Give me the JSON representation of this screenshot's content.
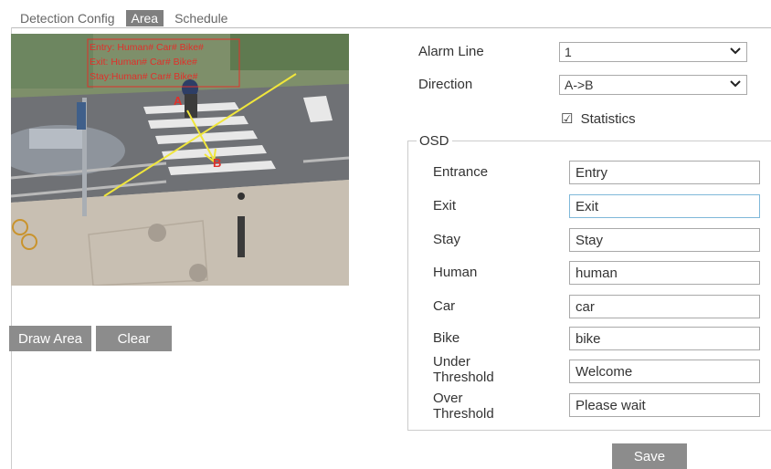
{
  "tabs": [
    {
      "label": "Detection Config",
      "active": false
    },
    {
      "label": "Area",
      "active": true
    },
    {
      "label": "Schedule",
      "active": false
    }
  ],
  "preview": {
    "overlay_lines": [
      "Entry:  Human# Car# Bike#",
      "Exit: Human# Car# Bike#",
      "Stay:Human# Car# Bike#"
    ],
    "point_a": "A",
    "point_b": "B",
    "colors": {
      "overlay_text": "#e0302a",
      "alarm_line": "#f0e63c"
    }
  },
  "buttons": {
    "draw_area": "Draw Area",
    "clear": "Clear",
    "save": "Save"
  },
  "alarm_line": {
    "label": "Alarm Line",
    "value": "1"
  },
  "direction": {
    "label": "Direction",
    "value": "A->B"
  },
  "statistics": {
    "label": "Statistics",
    "checked": true,
    "check_glyph": "☑"
  },
  "osd": {
    "legend": "OSD",
    "fields": [
      {
        "label": "Entrance",
        "value": "Entry"
      },
      {
        "label": "Exit",
        "value": "Exit"
      },
      {
        "label": "Stay",
        "value": "Stay"
      },
      {
        "label": "Human",
        "value": "human"
      },
      {
        "label": "Car",
        "value": "car"
      },
      {
        "label": "Bike",
        "value": "bike"
      },
      {
        "label_line1": "Under",
        "label_line2": "Threshold",
        "value": "Welcome"
      },
      {
        "label_line1": "Over",
        "label_line2": "Threshold",
        "value": "Please wait"
      }
    ]
  },
  "icons": {
    "dropdown": "chevron-down-icon"
  }
}
